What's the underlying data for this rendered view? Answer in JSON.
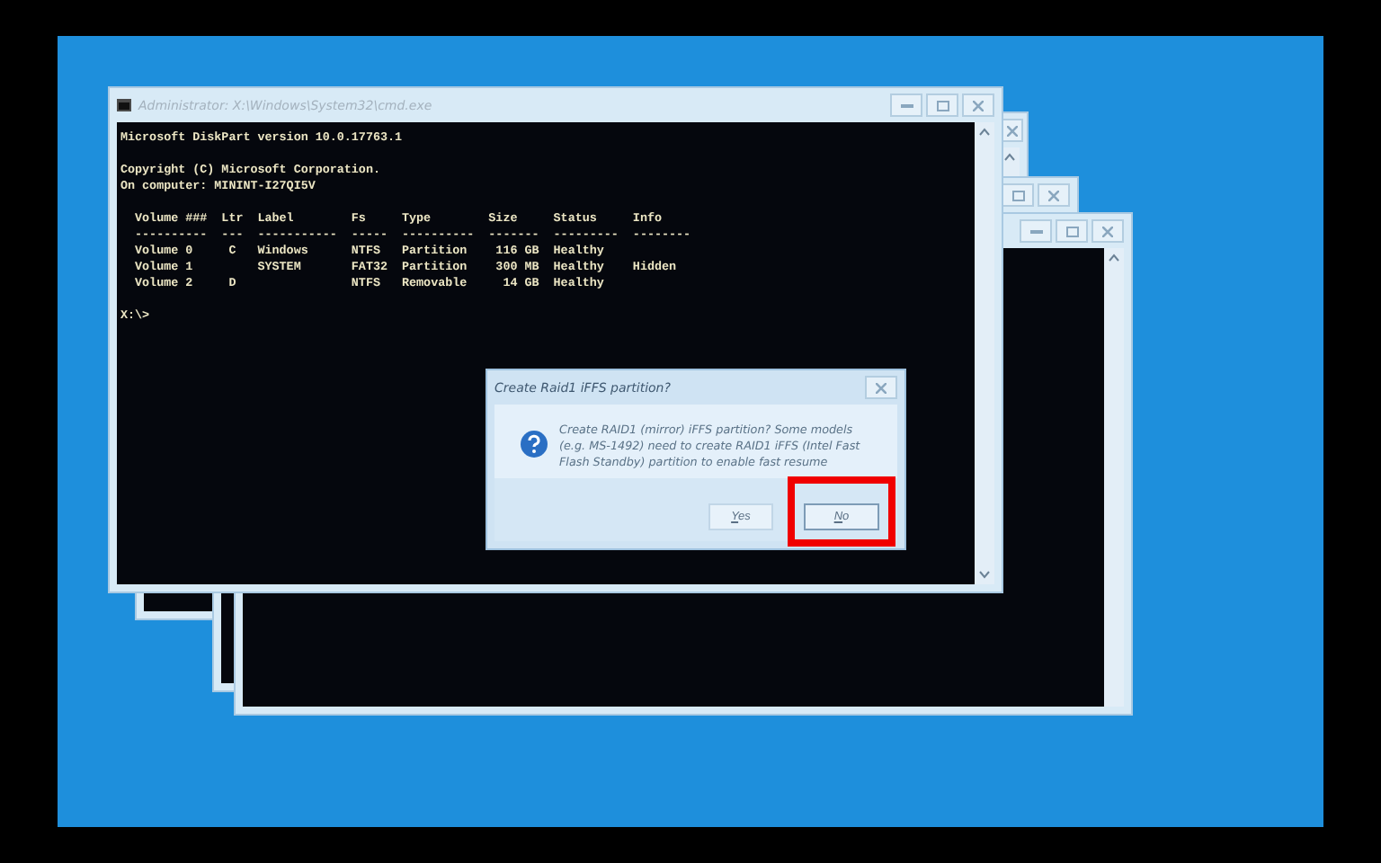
{
  "console_window": {
    "title": "Administrator: X:\\Windows\\System32\\cmd.exe",
    "blocks": [
      [
        "Microsoft DiskPart version 10.0.17763.1"
      ],
      [
        "Copyright (C) Microsoft Corporation.",
        "On computer: MININT-I27QI5V"
      ],
      [
        "  Volume ###  Ltr  Label        Fs     Type        Size     Status     Info",
        "  ----------  ---  -----------  -----  ----------  -------  ---------  --------",
        "  Volume 0     C   Windows      NTFS   Partition    116 GB  Healthy",
        "  Volume 1         SYSTEM       FAT32  Partition    300 MB  Healthy    Hidden",
        "  Volume 2     D                NTFS   Removable     14 GB  Healthy"
      ],
      [
        "X:\\>"
      ]
    ]
  },
  "dialog": {
    "title": "Create Raid1 iFFS partition?",
    "message": "Create RAID1 (mirror) iFFS partition? Some models (e.g. MS-1492) need to create RAID1 iFFS (Intel Fast Flash Standby) partition to enable fast resume",
    "buttons": [
      {
        "label": "Yes",
        "selected": false,
        "highlighted": false
      },
      {
        "label": "No",
        "selected": true,
        "highlighted": true
      }
    ]
  }
}
